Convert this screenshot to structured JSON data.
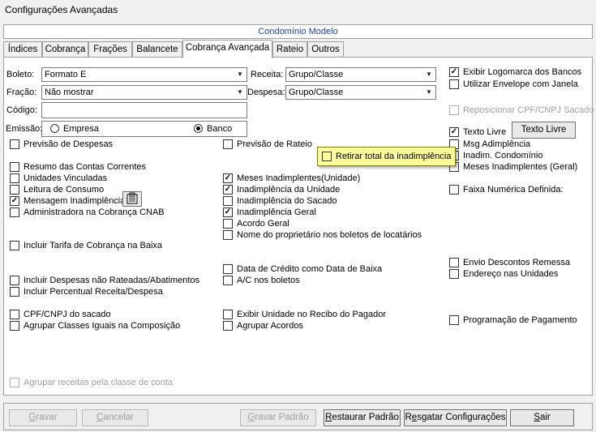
{
  "window": {
    "title": "Configurações Avançadas"
  },
  "banner": "Condomínio Modelo",
  "tabs": [
    {
      "label": "Índices"
    },
    {
      "label": "Cobrança"
    },
    {
      "label": "Frações"
    },
    {
      "label": "Balancete"
    },
    {
      "label": "Cobrança Avançada"
    },
    {
      "label": "Rateio"
    },
    {
      "label": "Outros"
    }
  ],
  "form": {
    "boleto_label": "Boleto:",
    "boleto_value": "Formato E",
    "receita_label": "Receita:",
    "receita_value": "Grupo/Classe",
    "fracao_label": "Fração:",
    "fracao_value": "Não mostrar",
    "despesa_label": "Despesa:",
    "despesa_value": "Grupo/Classe",
    "codigo_label": "Código:",
    "codigo_value": "",
    "emissao_label": "Emissão:",
    "emissao_empresa": "Empresa",
    "emissao_banco": "Banco",
    "texto_livre_button": "Texto Livre"
  },
  "checkboxes": {
    "exibir_logomarca": "Exibir Logomarca dos Bancos",
    "utilizar_envelope": "Utilizar Envelope com Janela",
    "reposicionar_cpf": "Reposicionar CPF/CNPJ Sacado",
    "texto_livre": "Texto Livre",
    "msg_adimplencia": "Msg Adimplência",
    "inadim_condominio": "Inadim. Condomínio",
    "meses_inadimplentes_geral": "Meses Inadimplentes (Geral)",
    "faixa_numerica": "Faixa Numérica Definida:",
    "previsao_despesas": "Previsão de Despesas",
    "previsao_rateio": "Previsão de Rateio",
    "resumo_contas": "Resumo das Contas Correntes",
    "unidades_vinculadas": "Unidades Vinculadas",
    "leitura_consumo": "Leitura de Consumo",
    "mensagem_inadimplencia": "Mensagem Inadimplência",
    "administradora_cnab": "Administradora na Cobrança CNAB",
    "meses_inadimplentes_unidade": "Meses Inadimplentes(Unidade)",
    "inadimplencia_unidade": "Inadimplência da Unidade",
    "inadimplencia_sacado": "Inadimplência do Sacado",
    "inadimplencia_geral": "Inadimplência Geral",
    "acordo_geral": "Acordo Geral",
    "nome_proprietario": "Nome do proprietário nos boletos de locatários",
    "incluir_tarifa": "Incluir Tarifa de Cobrança na Baixa",
    "data_credito": "Data de Crédito como Data de Baixa",
    "ac_boletos": "A/C nos boletos",
    "envio_descontos": "Envio Descontos Remessa",
    "endereco_unidades": "Endereço nas Unidades",
    "incluir_despesas": "Incluir Despesas não Rateadas/Abatimentos",
    "incluir_percentual": "Incluir Percentual Receita/Despesa",
    "cpf_sacado": "CPF/CNPJ do sacado",
    "agrupar_classes": "Agrupar Classes Iguais na Composição",
    "exibir_unidade_recibo": "Exibir Unidade no Recibo do Pagador",
    "agrupar_acordos": "Agrupar Acordos",
    "programacao_pagamento": "Programação de Pagamento",
    "agrupar_receitas": "Agrupar receitas pela classe de conta"
  },
  "tooltip": {
    "text": "Retirar total da inadimplência"
  },
  "footer": {
    "gravar_pre": "",
    "gravar_u": "G",
    "gravar_post": "ravar",
    "cancelar_pre": "",
    "cancelar_u": "C",
    "cancelar_post": "ancelar",
    "gravar_padrao_pre": "",
    "gravar_padrao_u": "G",
    "gravar_padrao_post": "ravar Padrão",
    "restaurar_pre": "",
    "restaurar_u": "R",
    "restaurar_post": "estaurar Padrão",
    "resgatar_pre": "R",
    "resgatar_u": "e",
    "resgatar_post": "sgatar Configurações",
    "sair_pre": "",
    "sair_u": "S",
    "sair_post": "air"
  }
}
